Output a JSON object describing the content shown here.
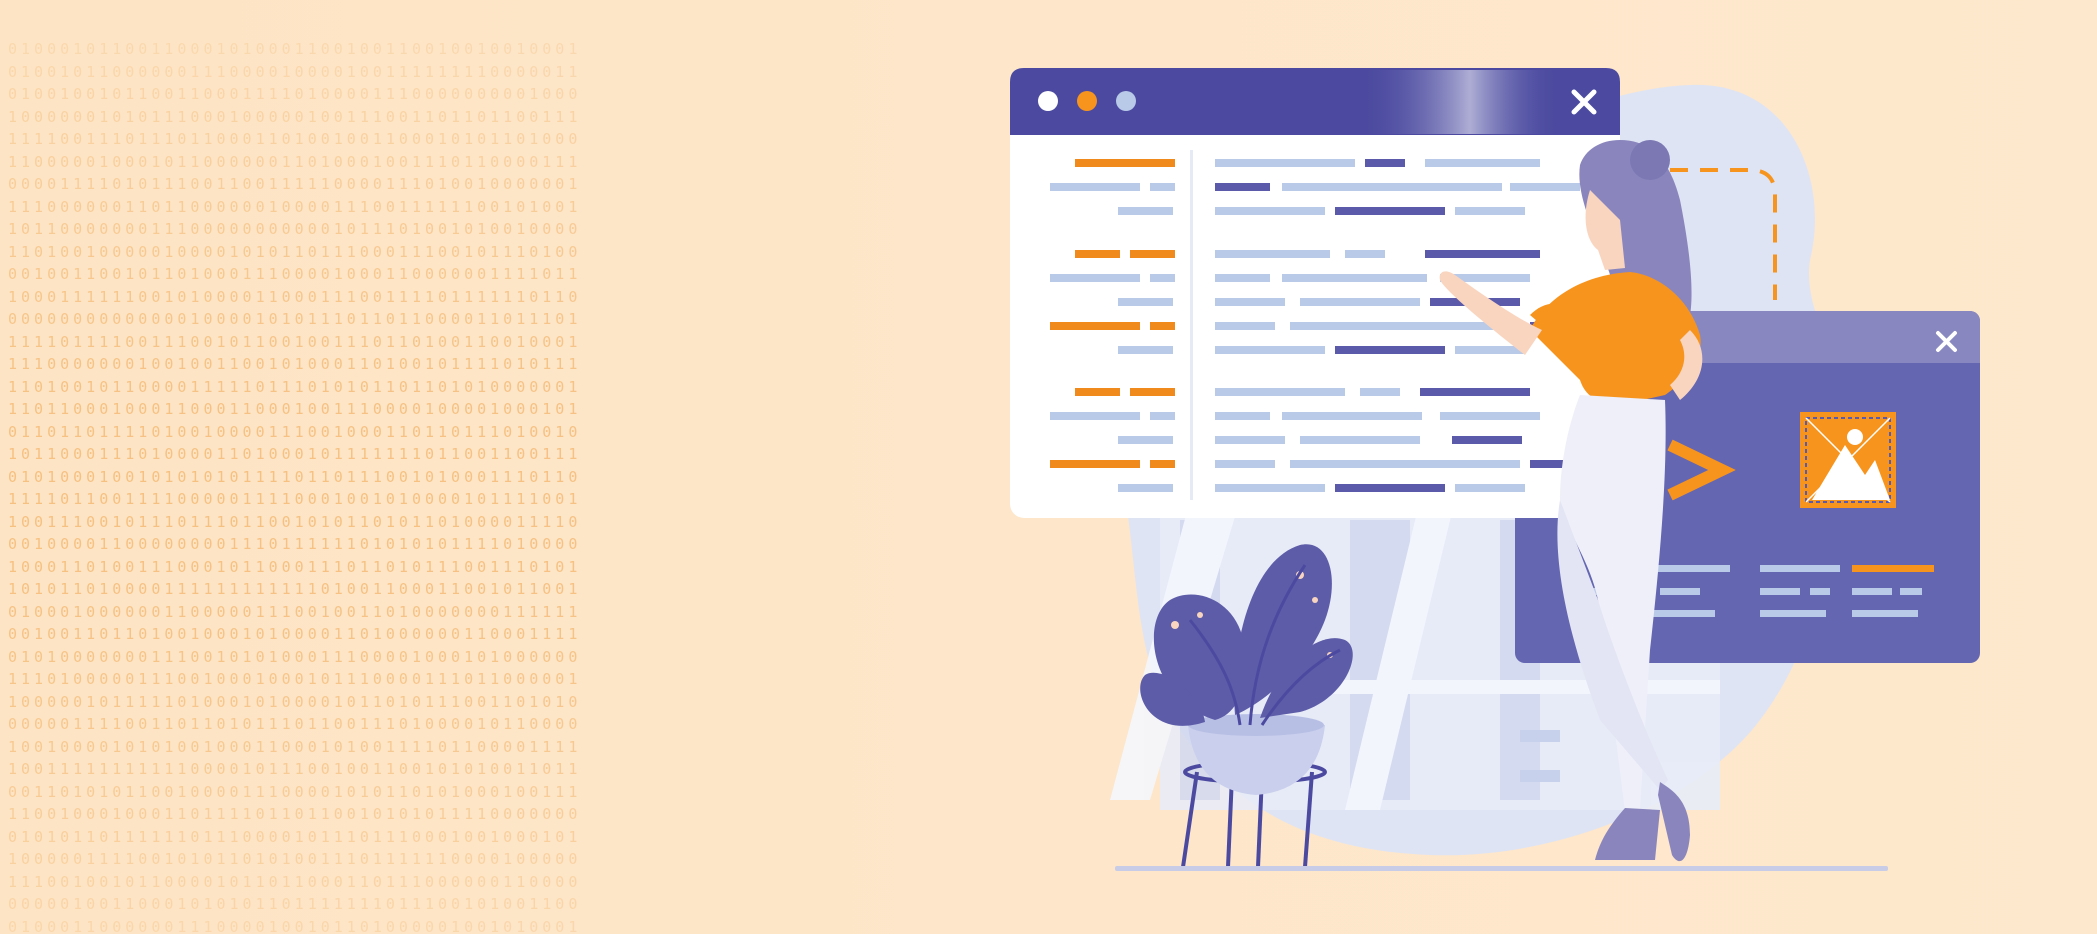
{
  "colors": {
    "background": "#fde6c8",
    "binary_text": "#f4b56b",
    "window_header": "#4b4aa0",
    "window_body": "#ffffff",
    "code_line_light": "#b9c9e8",
    "code_line_dark": "#5b5aaa",
    "code_line_accent": "#f08a1c",
    "secondary_window": "#6466b2",
    "blob": "#dde3f3",
    "person_shirt": "#f7941d",
    "person_hair": "#8a86bd",
    "person_pants": "#eeeff8",
    "plant_leaf": "#5d5ca8",
    "pot": "#c9cfec",
    "floor_line": "#c8cce6"
  },
  "icons": {
    "main_window_close": "close-icon",
    "secondary_window_close": "close-icon",
    "image_placeholder": "image-icon",
    "code_chevron": "chevron-right-icon"
  },
  "binary_seed": 7
}
